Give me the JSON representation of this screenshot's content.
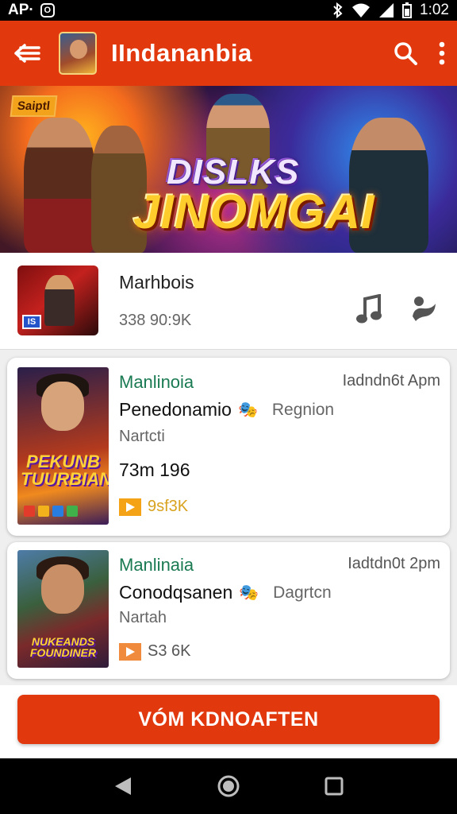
{
  "status_bar": {
    "left_text": "AP·",
    "badge": "O",
    "time": "1:02"
  },
  "app_bar": {
    "title": "IIndananbia"
  },
  "banner": {
    "tag": "Saiptl",
    "line1": "DISLKS",
    "line2": "JINOMGAI"
  },
  "featured": {
    "title": "Marhbois",
    "meta": "338 90:9K"
  },
  "cards": [
    {
      "category": "Manlinoia",
      "time": "Iadndn6t Apm",
      "title": "Penedonamio",
      "region": "Regnion",
      "subtitle": "Nartcti",
      "size": "73m 196",
      "rating": "9sf3K",
      "cover_text": "PEKUNB TUURBIAN"
    },
    {
      "category": "Manlinaia",
      "time": "Iadtdn0t 2pm",
      "title": "Conodqsanen",
      "region": "Dagrtcn",
      "subtitle": "Nartah",
      "rating": "S3 6K",
      "cover_text": "NUKEANDS FOUNDINER"
    }
  ],
  "cta": {
    "label": "VÓM KDNOAFTEN"
  },
  "colors": {
    "primary": "#e2380e",
    "category": "#1a7a52",
    "rating_gold": "#d8a21e"
  },
  "icons": [
    "menu-back-icon",
    "search-icon",
    "more-vert-icon",
    "music-note-icon",
    "share-icon",
    "mask-icon",
    "play-flag-icon",
    "nav-back-icon",
    "nav-home-icon",
    "nav-recents-icon"
  ]
}
